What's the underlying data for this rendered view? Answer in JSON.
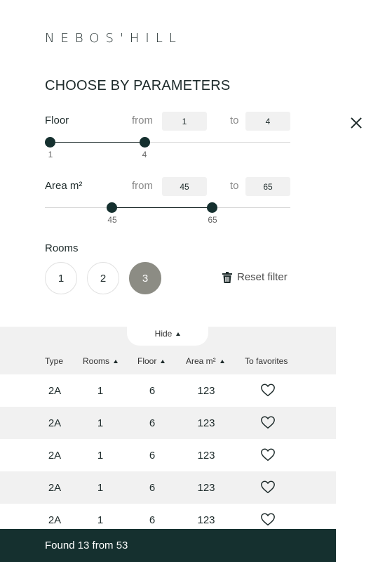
{
  "brand": {
    "logo": "NEBOS'HILL"
  },
  "filter": {
    "title": "CHOOSE BY PARAMETERS",
    "floor": {
      "label": "Floor",
      "from_label": "from",
      "to_label": "to",
      "from": "1",
      "to": "4",
      "min_label": "1",
      "max_label": "4",
      "range_from": 1,
      "range_to": 4
    },
    "area": {
      "label": "Area m²",
      "from_label": "from",
      "to_label": "to",
      "from": "45",
      "to": "65",
      "min_label": "45",
      "max_label": "65",
      "range_from": 45,
      "range_to": 65
    },
    "rooms": {
      "label": "Rooms",
      "options": [
        "1",
        "2",
        "3"
      ],
      "selected": "3"
    },
    "reset_label": "Reset filter"
  },
  "table": {
    "hide_label": "Hide",
    "columns": {
      "type": "Type",
      "rooms": "Rooms",
      "floor": "Floor",
      "area": "Area m²",
      "favorites": "To favorites"
    },
    "rows": [
      {
        "type": "2A",
        "rooms": "1",
        "floor": "6",
        "area": "123"
      },
      {
        "type": "2A",
        "rooms": "1",
        "floor": "6",
        "area": "123"
      },
      {
        "type": "2A",
        "rooms": "1",
        "floor": "6",
        "area": "123"
      },
      {
        "type": "2A",
        "rooms": "1",
        "floor": "6",
        "area": "123"
      },
      {
        "type": "2A",
        "rooms": "1",
        "floor": "6",
        "area": "123"
      }
    ]
  },
  "footer": {
    "found_text": "Found 13 from 53"
  },
  "colors": {
    "dark": "#15302f",
    "room_active": "#8c8c84",
    "row_alt": "#f1f1f1"
  },
  "icons": {
    "close": "close-icon",
    "reset": "trash-icon",
    "favorite": "heart-icon",
    "sort": "caret-up-icon"
  }
}
